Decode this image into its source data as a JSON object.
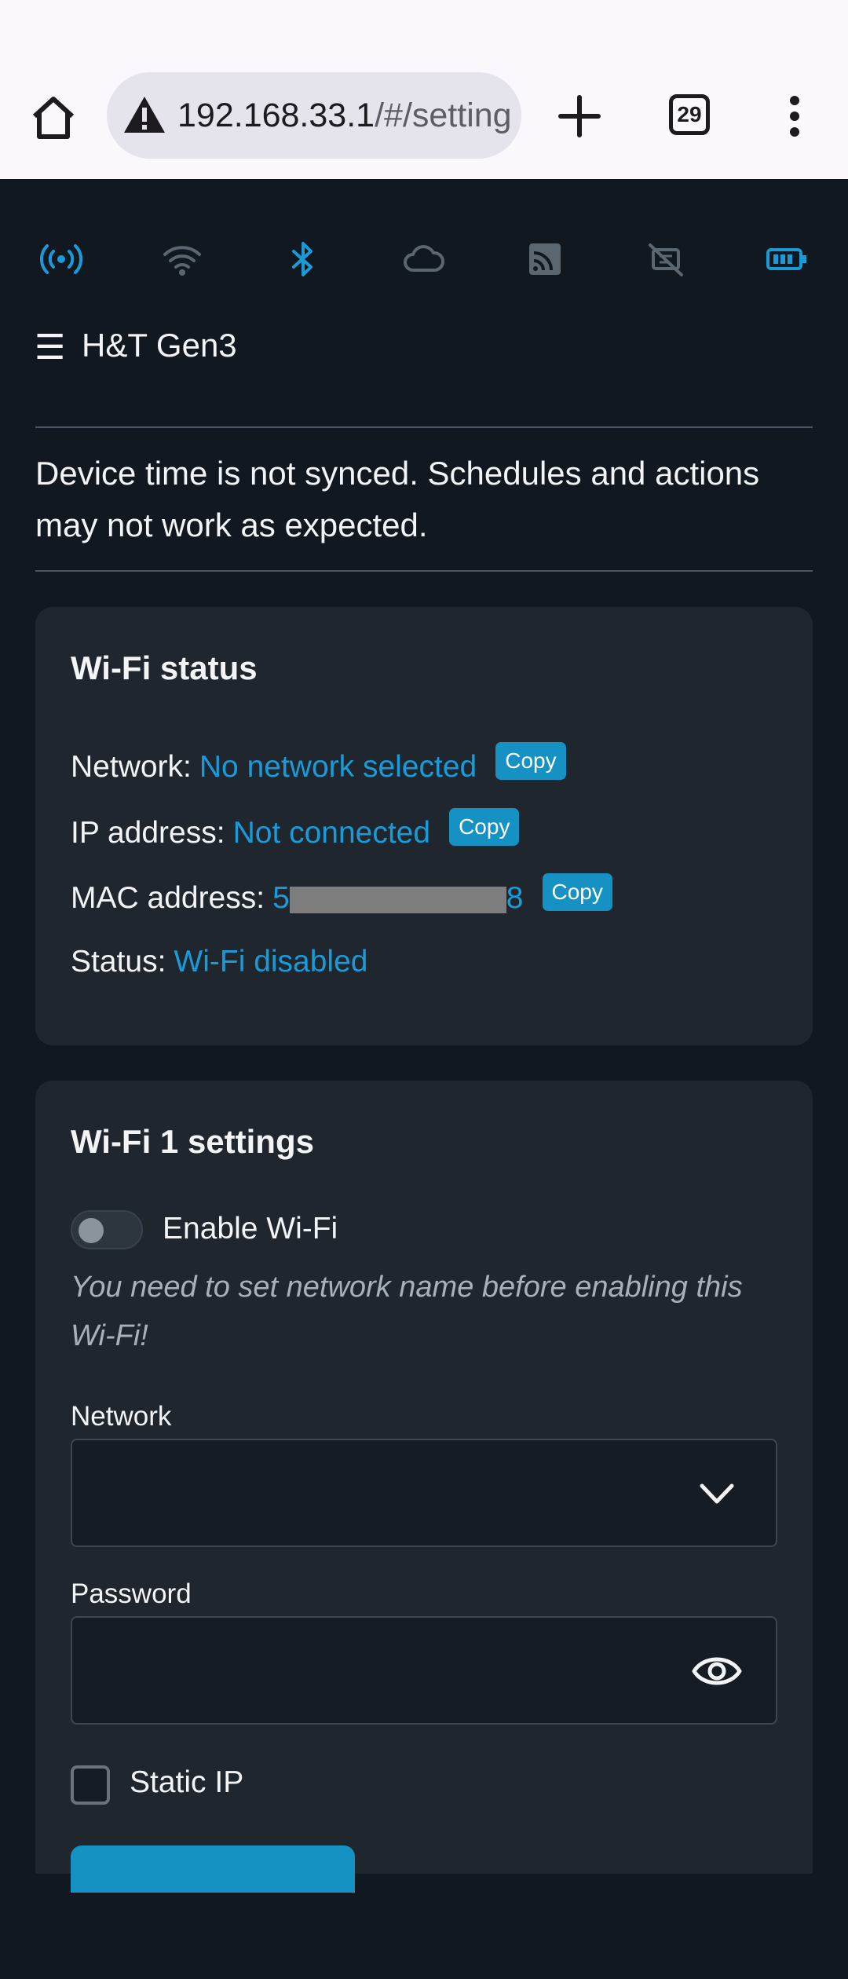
{
  "browser": {
    "url_host": "192.168.33.1",
    "url_path": "/#/setting",
    "tab_count": "29"
  },
  "status_icons": [
    {
      "name": "broadcast-icon",
      "color": "#1a9bd7"
    },
    {
      "name": "wifi-icon",
      "color": "#5b6670"
    },
    {
      "name": "bluetooth-icon",
      "color": "#1a9bd7"
    },
    {
      "name": "cloud-icon",
      "color": "#5b6670"
    },
    {
      "name": "rss-icon",
      "color": "#5b6670"
    },
    {
      "name": "ethernet-off-icon",
      "color": "#5b6670"
    },
    {
      "name": "battery-icon",
      "color": "#1a9bd7"
    }
  ],
  "header": {
    "menu_icon": "☰",
    "title": "H&T Gen3"
  },
  "notice": "Device time is not synced. Schedules and actions may not work as expected.",
  "wifi_status": {
    "title": "Wi-Fi status",
    "network_label": "Network:",
    "network_value": "No network selected",
    "ip_label": "IP address:",
    "ip_value": "Not connected",
    "mac_label": "MAC address:",
    "mac_start": "5",
    "mac_end": "8",
    "status_label": "Status:",
    "status_value": "Wi-Fi disabled",
    "copy_label": "Copy"
  },
  "wifi1": {
    "title": "Wi-Fi 1 settings",
    "enable_label": "Enable Wi-Fi",
    "enabled": false,
    "hint": "You need to set network name before enabling this Wi-Fi!",
    "network_label": "Network",
    "password_label": "Password",
    "static_ip_label": "Static IP",
    "static_ip_checked": false
  },
  "colors": {
    "accent": "#1a9bd7",
    "button": "#1591c4",
    "background": "#111820",
    "card": "#1f262e"
  }
}
